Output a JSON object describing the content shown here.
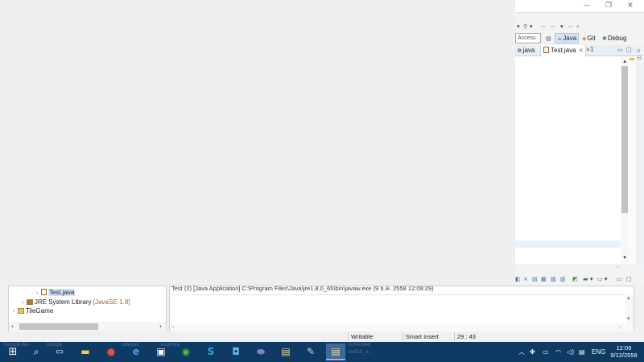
{
  "window": {
    "buttons": {
      "minimize": "—",
      "maximize": "❐",
      "close": "✕"
    }
  },
  "toolbar": {
    "quick_access": "Access",
    "perspectives": [
      {
        "label": "Java",
        "icon": "java-perspective-icon",
        "active": true
      },
      {
        "label": "Git",
        "icon": "git-icon",
        "active": false
      },
      {
        "label": "Debug",
        "icon": "debug-icon",
        "active": false
      }
    ]
  },
  "editor": {
    "tabs": [
      {
        "label": "e.java",
        "active": false
      },
      {
        "label": "Test.java",
        "active": true
      }
    ],
    "overflow_indicator": "»1",
    "nav_right": "›"
  },
  "package_explorer": {
    "items": [
      {
        "label": "Test.java",
        "selected": true
      },
      {
        "label": "JRE System Library",
        "qualifier": "[JavaSE-1.8]"
      },
      {
        "label": "TileGame"
      }
    ]
  },
  "console": {
    "header": "Test (2) [Java Application] C:\\Program Files\\Java\\jre1.8.0_65\\bin\\javaw.exe (9 ธ.ค. 2558 12:09:29)"
  },
  "statusbar": {
    "writable": "Writable",
    "insert_mode": "Smart Insert",
    "position": "29 : 43"
  },
  "taskbar": {
    "ghost_text": {
      "left_1": "Recycle Bin",
      "left_2": "Google",
      "left_3": "นพพนงจ",
      "pinned_label": "ยนตกตน",
      "side_1": "Unfinished",
      "side_2": "บทที่15_a..."
    },
    "language": "ENG",
    "time": "12:09",
    "date": "9/12/2558"
  },
  "colors": {
    "taskbar": "#0f3a63",
    "active_perspective": "#d6e5f5",
    "selection": "#cce4fb",
    "current_line": "#e8f2fe"
  }
}
